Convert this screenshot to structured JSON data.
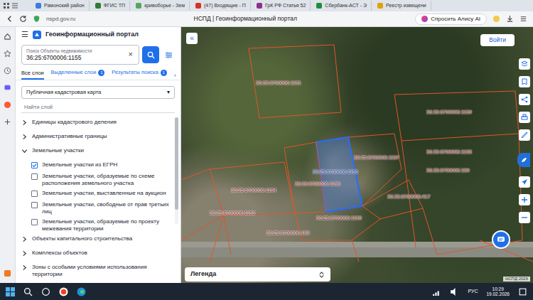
{
  "browser": {
    "tabs": [
      "Рамонский район",
      "ФГИС ТП",
      "кривоборье - Зем",
      "(47) Входящие - П",
      "ГрК РФ Статья 52",
      "Сбербанк-АСТ - Э",
      "Реестр извещени"
    ],
    "address": "nspd.gov.ru",
    "page_title": "НСПД | Геоинформационный портал",
    "alice_button": "Спросить Алису AI"
  },
  "portal": {
    "menu_icon": "☰",
    "title": "Геоинформационный портал",
    "search": {
      "label": "Поиск Объекты недвижимости",
      "value": "36:25:6700006:1155",
      "clear": "×"
    },
    "tabs": [
      {
        "label": "Все слои",
        "selected": true
      },
      {
        "label": "Выделенные слои",
        "badge": "1",
        "selected": false
      },
      {
        "label": "Результаты поиска",
        "badge": "1",
        "selected": false
      }
    ],
    "tabs_more": "›",
    "basemap": "Публичная кадастровая карта",
    "dropdown_caret": "▾",
    "layer_search_placeholder": "Найти слой",
    "layers": [
      {
        "kind": "group",
        "label": "Единицы кадастрового деления",
        "expanded": false
      },
      {
        "kind": "group",
        "label": "Административные границы",
        "expanded": false
      },
      {
        "kind": "group",
        "label": "Земельные участки",
        "expanded": true
      },
      {
        "kind": "layer",
        "label": "Земельные участки из ЕГРН",
        "checked": true
      },
      {
        "kind": "layer",
        "label": "Земельные участки, образуемые по схеме расположения земельного участка",
        "checked": false
      },
      {
        "kind": "layer",
        "label": "Земельные участки, выставленные на аукцион",
        "checked": false
      },
      {
        "kind": "layer",
        "label": "Земельные участки, свободные от прав третьих лиц",
        "checked": false
      },
      {
        "kind": "layer",
        "label": "Земельные участки, образуемые по проекту межевания территории",
        "checked": false
      },
      {
        "kind": "group",
        "label": "Объекты капитального строительства",
        "expanded": false
      },
      {
        "kind": "group",
        "label": "Комплексы объектов",
        "expanded": false
      },
      {
        "kind": "group",
        "label": "Зоны с особыми условиями использования территории",
        "expanded": false
      }
    ]
  },
  "map": {
    "collapse": "«",
    "login": "Войти",
    "legend": "Легенда",
    "attribution": "НСПД 2026",
    "parcels": [
      {
        "label": "36:25:6700006:1151",
        "selected": false
      },
      {
        "label": "36:25:6700006:1159",
        "selected": false
      },
      {
        "label": "36:25:6700006:1157",
        "selected": false
      },
      {
        "label": "36:25:6700006:1155",
        "selected": true
      },
      {
        "label": "36:25:6700006:1156",
        "selected": false
      },
      {
        "label": "36:25:6700006:1158",
        "selected": false
      },
      {
        "label": "36:25:6700006:199",
        "selected": false
      },
      {
        "label": "36:25:6700006:417",
        "selected": false
      },
      {
        "label": "36:25:6700006:1154",
        "selected": false
      },
      {
        "label": "36:25:6700006:1153",
        "selected": false
      },
      {
        "label": "36:25:6700006:1150",
        "selected": false
      },
      {
        "label": "36:25:6700006:189",
        "selected": false
      }
    ]
  },
  "taskbar": {
    "lang": "РУС",
    "time": "10:29",
    "date": "19.02.2026"
  }
}
